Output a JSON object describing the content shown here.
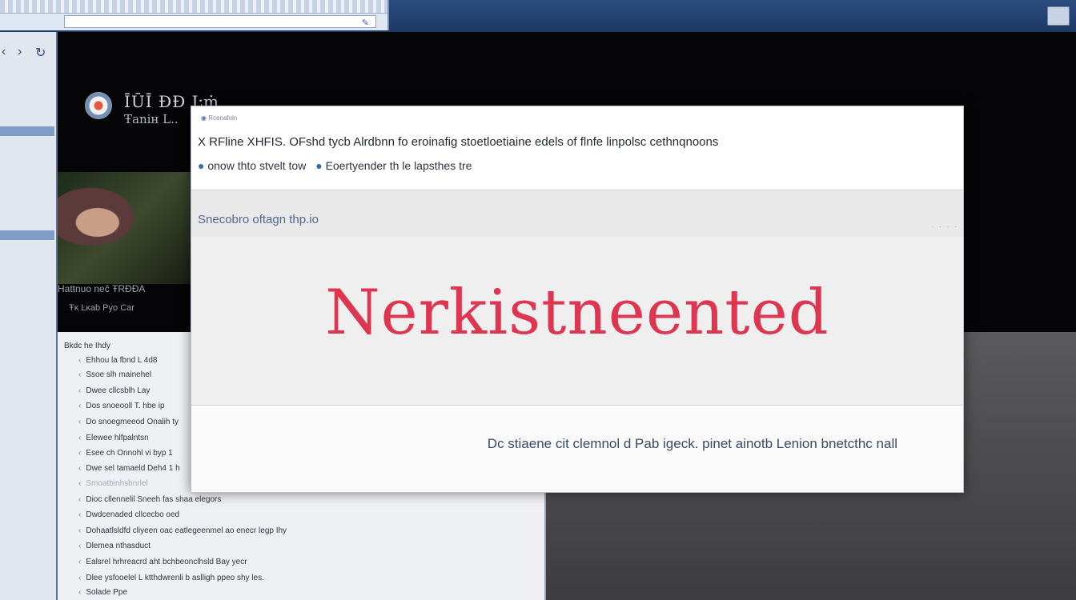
{
  "topbar": {
    "address": "",
    "window_button": ""
  },
  "sidebar": {
    "nav_back": "‹",
    "nav_forward": "›",
    "nav_refresh": "↻",
    "items": [
      "",
      "",
      "",
      "",
      "",
      "",
      ""
    ]
  },
  "profile": {
    "title": "ĪŪĪ ÐÐ Ŀṁ",
    "subtitle": "Ŧaniʜ L..",
    "caption": "Hatŧnuo neĉ ŦRĐÐA",
    "meta": "Ŧĸ Ŀĸab Pyo Car"
  },
  "list": {
    "heading": "Bkdc he Ihdy",
    "items": [
      "Ehhou la fbnd L 4d8",
      "Ssoe slh mainehel",
      "Dwee cllcsblh Lay",
      "Dos snoeooll T. hbe ip",
      "Do snoegmeeod Onalih ty",
      "Elewee hlfpalntsn",
      "Esee ch Onnohl vi byp 1",
      "Dwe sel tamaeld Deh4 1 h",
      "Smoatbinhsbnrlel",
      "Dioc cllennelil Sneeh fas shaa elegors",
      "Dwdcenaded cllcecbo oed",
      "Dohaatlsldfd cliyeen oac eatlegeenmel ao enecr legp Ihy",
      "Dlemea nthasduct",
      "Ealsrel hrhreacrd aht bchbeonclhsld Bay yecr",
      "Dlee ysfooelel L ktthdwrenli b aslligh ppeo shy les.",
      "Solade Ppe"
    ]
  },
  "dialog": {
    "crumb": "Rcenafoln",
    "line1": "X RFline XHFIS. OFshd tycb Alrdbnn fo eroinafig stoetloetiaine edels of flnfe linpolsc cethnqnoons",
    "line2_a": "onow thto stvelt tow",
    "line2_b": "Eoertyender th le lapsthes tre",
    "section_title": "Snecobro oftagn thp.io",
    "section_dots": ". . . .",
    "status": "Nerkistneented",
    "footer": "Dc stiaene cit clemnol d Pab igeck. pinet ainotb Lenion bnetcthc nall"
  },
  "colors": {
    "status_red": "#de3550",
    "accent_blue": "#3867b8"
  }
}
